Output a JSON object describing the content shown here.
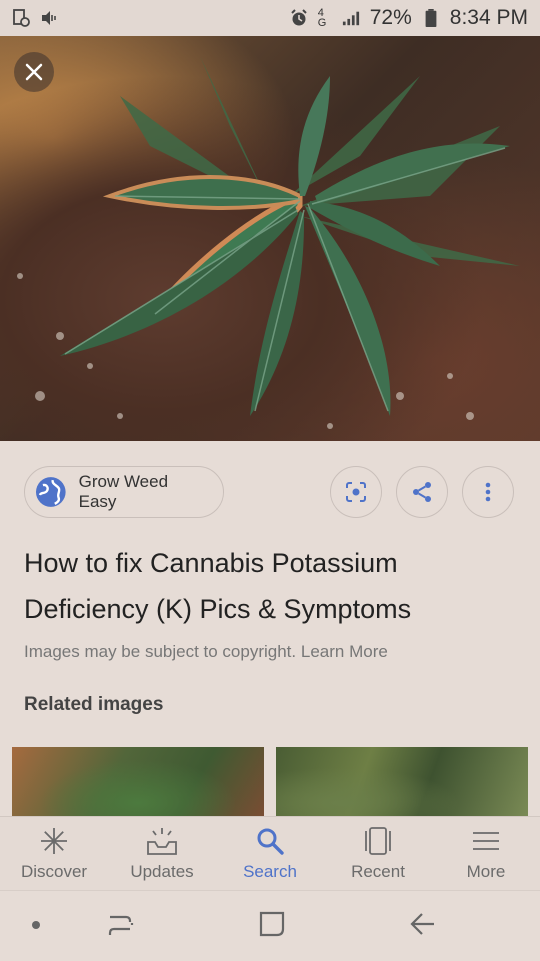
{
  "status_bar": {
    "battery": "72%",
    "time": "8:34 PM",
    "network_label": "4G",
    "icons": [
      "screenshot-icon",
      "volume-icon",
      "alarm-icon",
      "data-icon",
      "signal-icon",
      "battery-icon"
    ]
  },
  "hero": {
    "close_icon": "close-icon"
  },
  "source": {
    "name": "Grow Weed Easy",
    "icon": "globe-icon",
    "actions": [
      "lens-icon",
      "share-icon",
      "more-vert-icon"
    ]
  },
  "result": {
    "title": "How to fix Cannabis Potassium Deficiency (K) Pics & Symptoms",
    "copyright_text": "Images may be subject to copyright.",
    "learn_more": "Learn More"
  },
  "related": {
    "heading": "Related images"
  },
  "bottom_nav": {
    "items": [
      {
        "label": "Discover",
        "icon": "asterisk-icon"
      },
      {
        "label": "Updates",
        "icon": "updates-icon"
      },
      {
        "label": "Search",
        "icon": "search-icon"
      },
      {
        "label": "Recent",
        "icon": "recent-icon"
      },
      {
        "label": "More",
        "icon": "menu-icon"
      }
    ],
    "active": "Search"
  },
  "colors": {
    "accent": "#4f73c9",
    "background": "#e6dcd6",
    "text_primary": "#222222",
    "text_secondary": "#777777"
  }
}
